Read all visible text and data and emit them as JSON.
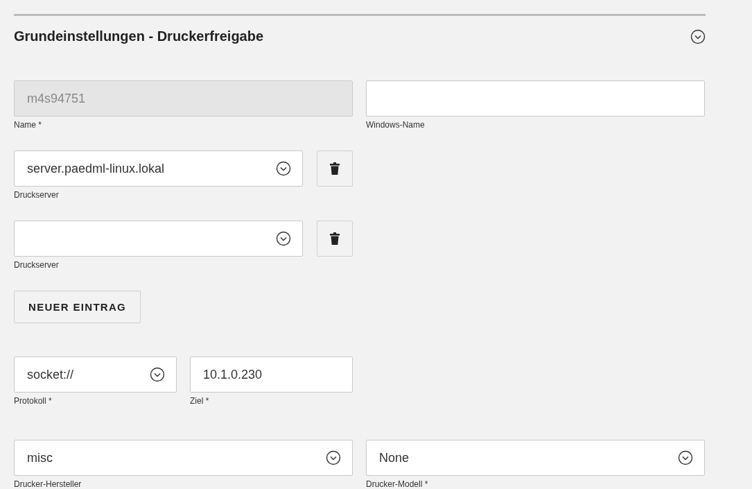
{
  "section": {
    "title": "Grundeinstellungen - Druckerfreigabe",
    "expanded": true
  },
  "rows": [
    {
      "kind": "fields",
      "fields": [
        {
          "kind": "text",
          "value": "m4s94751",
          "label": "Name *",
          "disabled": true
        },
        {
          "kind": "text",
          "label": "Windows-Name",
          "disabled": false
        }
      ]
    },
    {
      "kind": "server",
      "fields": [
        {
          "kind": "select",
          "value": "server.paedml-linux.lokal",
          "label": "Druckserver",
          "disabled": false
        }
      ]
    },
    {
      "kind": "server",
      "fields": [
        {
          "kind": "select",
          "label": "Druckserver",
          "disabled": false
        }
      ]
    },
    {
      "kind": "button",
      "label": "NEUER EINTRAG"
    },
    {
      "kind": "fields",
      "fields": [
        {
          "kind": "select",
          "value": "socket://",
          "label": "Protokoll *",
          "disabled": false
        },
        {
          "kind": "text",
          "value": "10.1.0.230",
          "label": "Ziel *",
          "disabled": false
        }
      ]
    },
    {
      "kind": "fields",
      "fields": [
        {
          "kind": "select",
          "value": "misc",
          "label": "Drucker-Hersteller",
          "disabled": false
        },
        {
          "kind": "select",
          "value": "None",
          "label": "Drucker-Modell *",
          "disabled": false
        }
      ]
    }
  ]
}
